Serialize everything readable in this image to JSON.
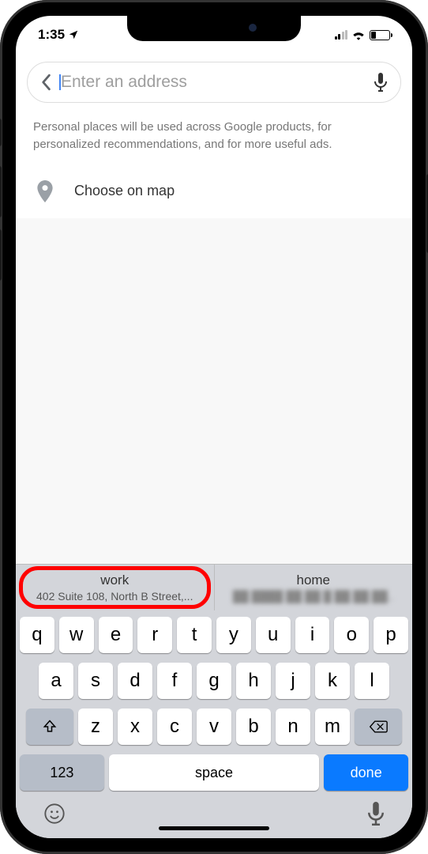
{
  "status": {
    "time": "1:35"
  },
  "search": {
    "placeholder": "Enter an address"
  },
  "info": "Personal places will be used across Google products, for personalized recommendations, and for more useful ads.",
  "map_option": "Choose on map",
  "suggestions": [
    {
      "title": "work",
      "subtitle": "402 Suite 108, North B Street,..."
    },
    {
      "title": "home",
      "subtitle": ""
    }
  ],
  "keyboard": {
    "row1": [
      "q",
      "w",
      "e",
      "r",
      "t",
      "y",
      "u",
      "i",
      "o",
      "p"
    ],
    "row2": [
      "a",
      "s",
      "d",
      "f",
      "g",
      "h",
      "j",
      "k",
      "l"
    ],
    "row3": [
      "z",
      "x",
      "c",
      "v",
      "b",
      "n",
      "m"
    ],
    "numbers": "123",
    "space": "space",
    "done": "done"
  }
}
